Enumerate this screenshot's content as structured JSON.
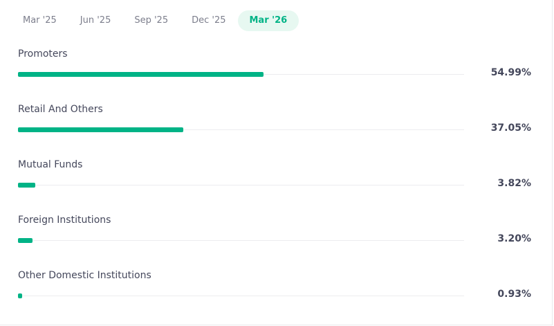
{
  "tabs": [
    {
      "label": "Mar '25",
      "active": false
    },
    {
      "label": "Jun '25",
      "active": false
    },
    {
      "label": "Sep '25",
      "active": false
    },
    {
      "label": "Dec '25",
      "active": false
    },
    {
      "label": "Mar '26",
      "active": true
    }
  ],
  "holdings": [
    {
      "label": "Promoters",
      "value_text": "54.99%",
      "percent": 54.99
    },
    {
      "label": "Retail And Others",
      "value_text": "37.05%",
      "percent": 37.05
    },
    {
      "label": "Mutual Funds",
      "value_text": "3.82%",
      "percent": 3.82
    },
    {
      "label": "Foreign Institutions",
      "value_text": "3.20%",
      "percent": 3.2
    },
    {
      "label": "Other Domestic Institutions",
      "value_text": "0.93%",
      "percent": 0.93
    }
  ],
  "colors": {
    "accent": "#00b386",
    "active_tab_bg": "#e7f8f1",
    "track": "#ececef",
    "text": "#44475b",
    "muted_text": "#7c7e8c"
  }
}
